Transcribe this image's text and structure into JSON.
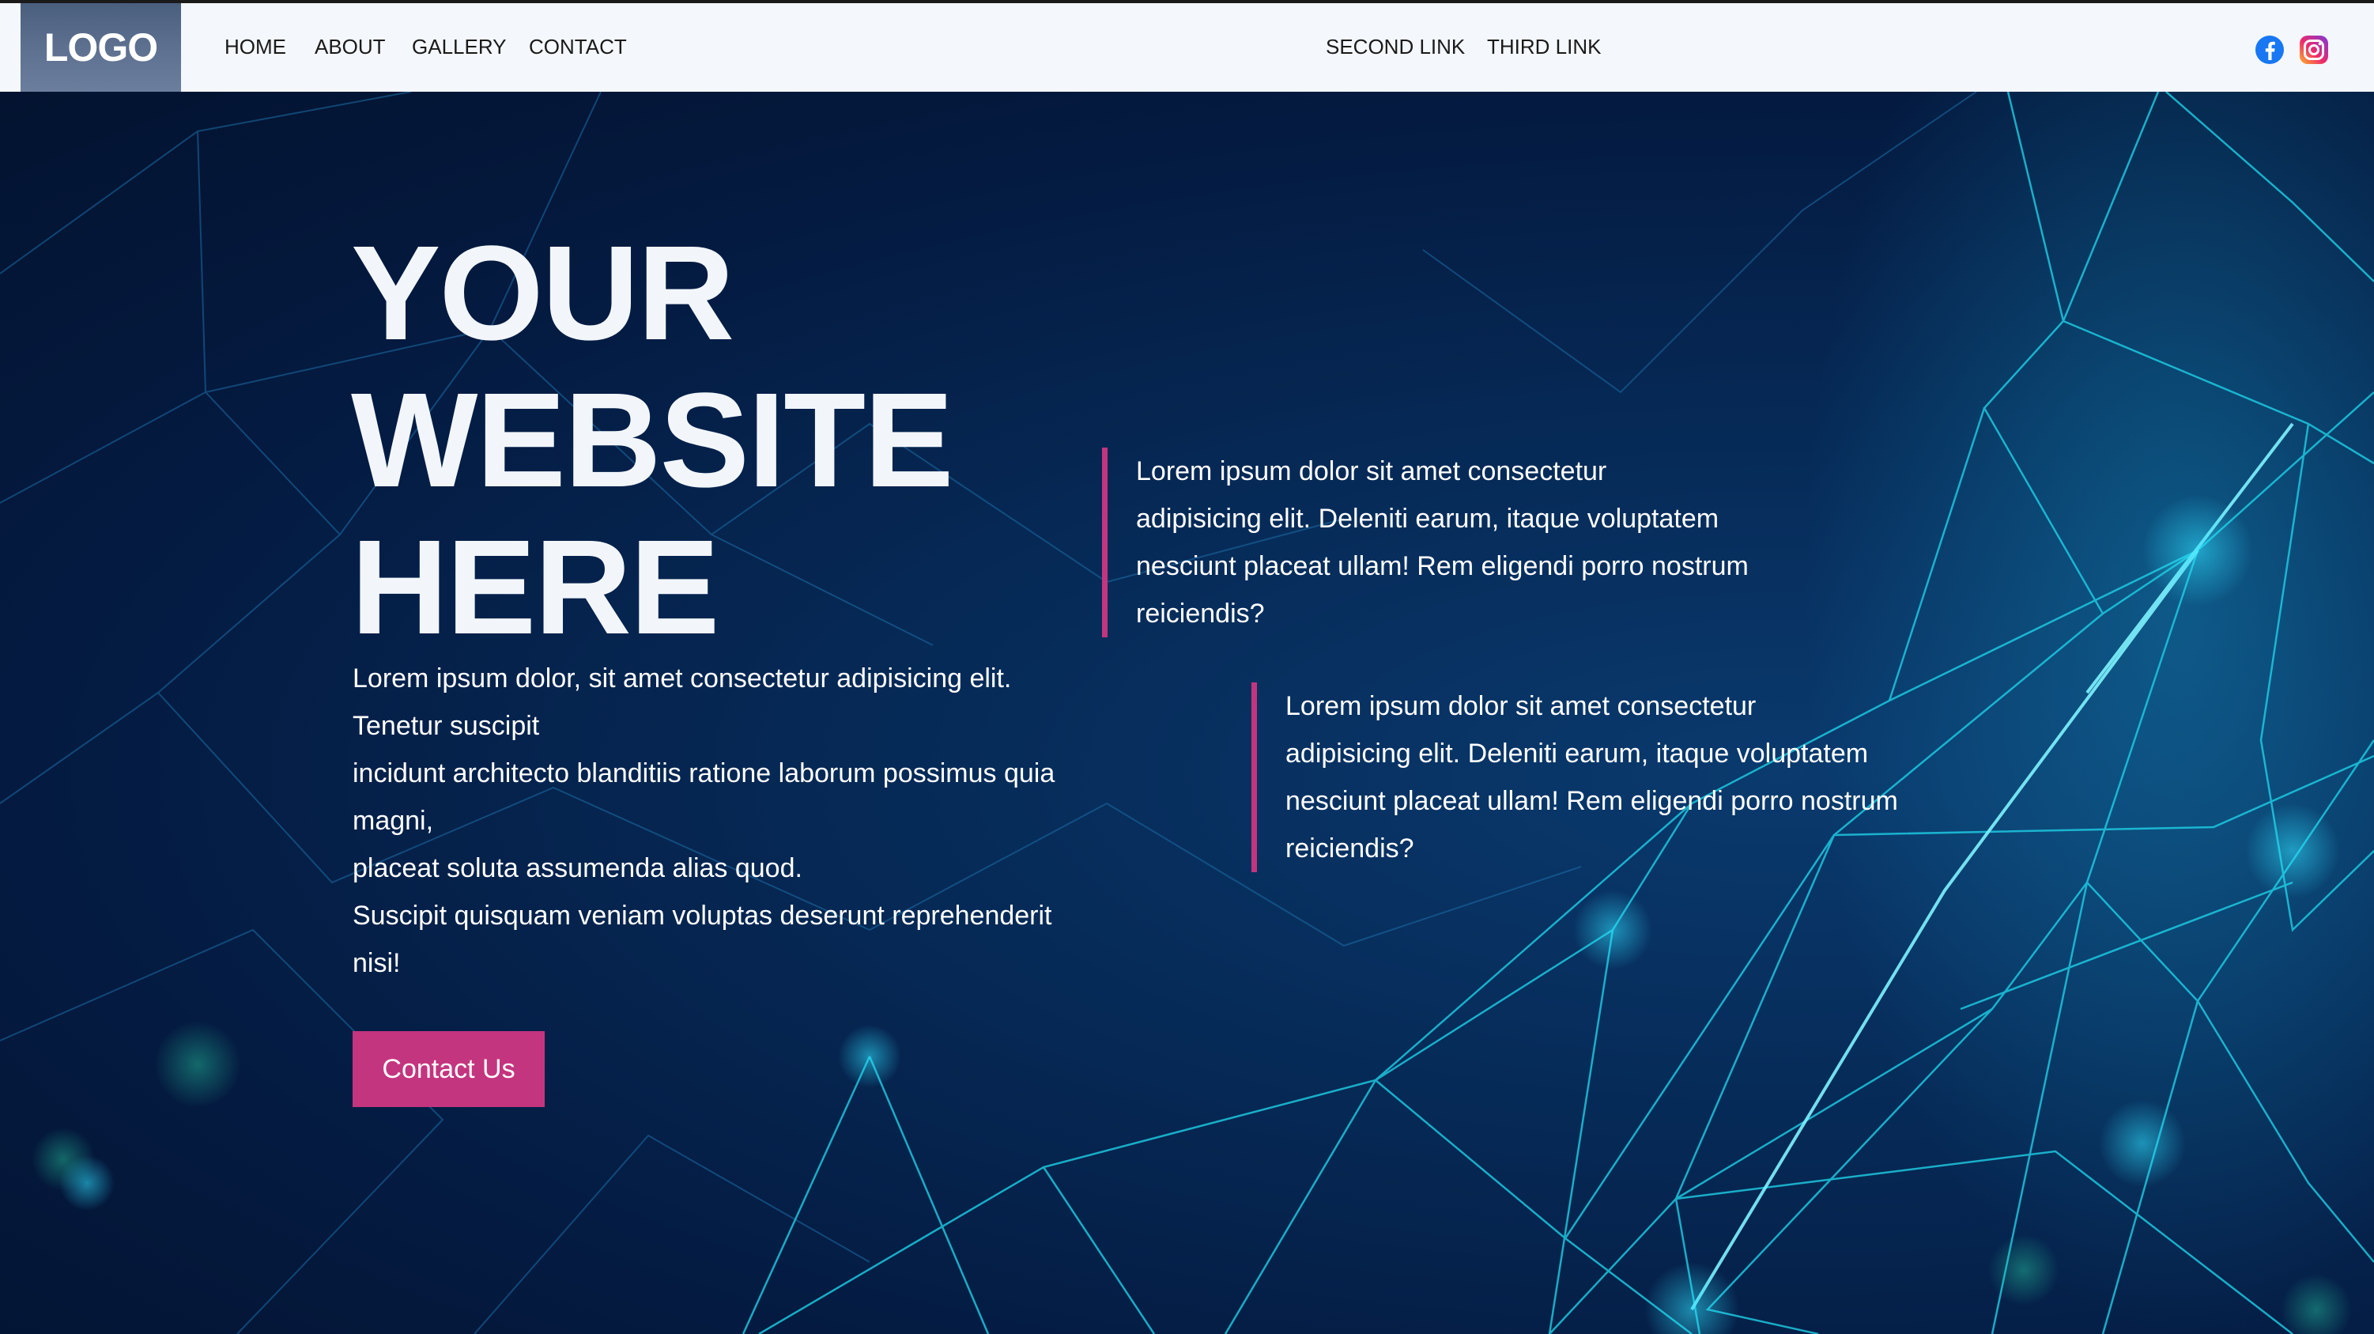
{
  "brand": {
    "logo_text": "LOGO"
  },
  "nav": {
    "left_links": [
      "HOME",
      "ABOUT",
      "GALLERY",
      "CONTACT"
    ],
    "right_links": [
      "SECOND LINK",
      "THIRD LINK"
    ],
    "social": [
      {
        "icon": "facebook-icon",
        "color": "#1877f2"
      },
      {
        "icon": "instagram-icon",
        "color": "#e1306c"
      }
    ]
  },
  "hero": {
    "headline_lines": [
      "YOUR",
      "WEBSITE",
      "HERE"
    ],
    "lead_lines": [
      "Lorem ipsum dolor, sit amet consectetur adipisicing elit.",
      "Tenetur suscipit",
      "incidunt architecto blanditiis ratione laborum possimus quia",
      "magni,",
      "placeat soluta assumenda alias quod.",
      "Suscipit quisquam veniam voluptas deserunt reprehenderit",
      "nisi!"
    ],
    "cta_label": "Contact Us"
  },
  "quotes": [
    {
      "lines": [
        "Lorem ipsum dolor sit amet consectetur",
        "adipisicing elit. Deleniti earum, itaque voluptatem",
        "nesciunt placeat ullam! Rem eligendi porro nostrum",
        "reiciendis?"
      ]
    },
    {
      "lines": [
        "Lorem ipsum dolor sit amet consectetur",
        "adipisicing elit. Deleniti earum, itaque voluptatem",
        "nesciunt placeat ullam! Rem eligendi porro nostrum",
        "reiciendis?"
      ]
    }
  ],
  "colors": {
    "accent": "#c4357f",
    "hero_bg": "#041a40",
    "network_lines": "#1fd0e6",
    "nav_bg": "#f4f7fb"
  }
}
